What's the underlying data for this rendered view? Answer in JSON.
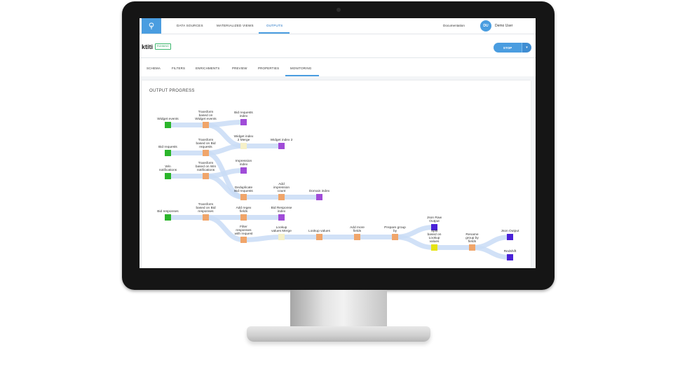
{
  "topnav": {
    "items": [
      "DATA SOURCES",
      "MATERIALIZED VIEWS",
      "OUTPUTS"
    ],
    "active": "OUTPUTS",
    "documentation": "Documentation",
    "user_initials": "DU",
    "user_name": "Demo User"
  },
  "header": {
    "title": "ktiti",
    "status": "RUNNING",
    "stop_label": "STOP",
    "caret": "▾"
  },
  "tabs": {
    "items": [
      "SCHEMA",
      "FILTERS",
      "ENRICHMENTS",
      "PREVIEW",
      "PROPERTIES",
      "MONITORING"
    ],
    "active": "MONITORING"
  },
  "monitoring": {
    "title": "OUTPUT PROGRESS",
    "nodes": [
      {
        "label": "Widget events",
        "color": "green"
      },
      {
        "label": "Bid requests",
        "color": "green"
      },
      {
        "label": "Win notifications",
        "color": "green"
      },
      {
        "label": "Bid responses",
        "color": "green"
      },
      {
        "label": "Transform based on Widget events",
        "color": "orange"
      },
      {
        "label": "Transform based on Bid requests",
        "color": "orange"
      },
      {
        "label": "Transform based on Win notifications",
        "color": "orange"
      },
      {
        "label": "Transform based on Bid responses",
        "color": "orange"
      },
      {
        "label": "Bid requests index",
        "color": "purple"
      },
      {
        "label": "Widget index 2 Merge",
        "color": "pale"
      },
      {
        "label": "Widget index 2",
        "color": "purple"
      },
      {
        "label": "Impression index",
        "color": "purple"
      },
      {
        "label": "Deduplicate Bid requests",
        "color": "orange"
      },
      {
        "label": "Add impression count",
        "color": "orange"
      },
      {
        "label": "Domain index",
        "color": "purple"
      },
      {
        "label": "Add regex fields",
        "color": "orange"
      },
      {
        "label": "Bid Response index",
        "color": "purple"
      },
      {
        "label": "Filter responses with request",
        "color": "orange"
      },
      {
        "label": "Lookup values Merge",
        "color": "pale"
      },
      {
        "label": "Lookup values",
        "color": "orange"
      },
      {
        "label": "Add more fields",
        "color": "orange"
      },
      {
        "label": "Prepare group by",
        "color": "orange"
      },
      {
        "label": "Json Raw Output",
        "color": "violet"
      },
      {
        "label": "Split based on Lookup values",
        "color": "yellow"
      },
      {
        "label": "Rename group by fields",
        "color": "orange"
      },
      {
        "label": "Json Output",
        "color": "violet"
      },
      {
        "label": "Redshift",
        "color": "violet"
      }
    ]
  },
  "colors": {
    "accent": "#4a9de0",
    "running": "#2ea45f",
    "edge": "#c9dcf6",
    "green": "#2bb52b",
    "orange": "#f0a56a",
    "purple": "#a04cd8",
    "violet": "#4a22d8",
    "yellow": "#e6e314"
  }
}
